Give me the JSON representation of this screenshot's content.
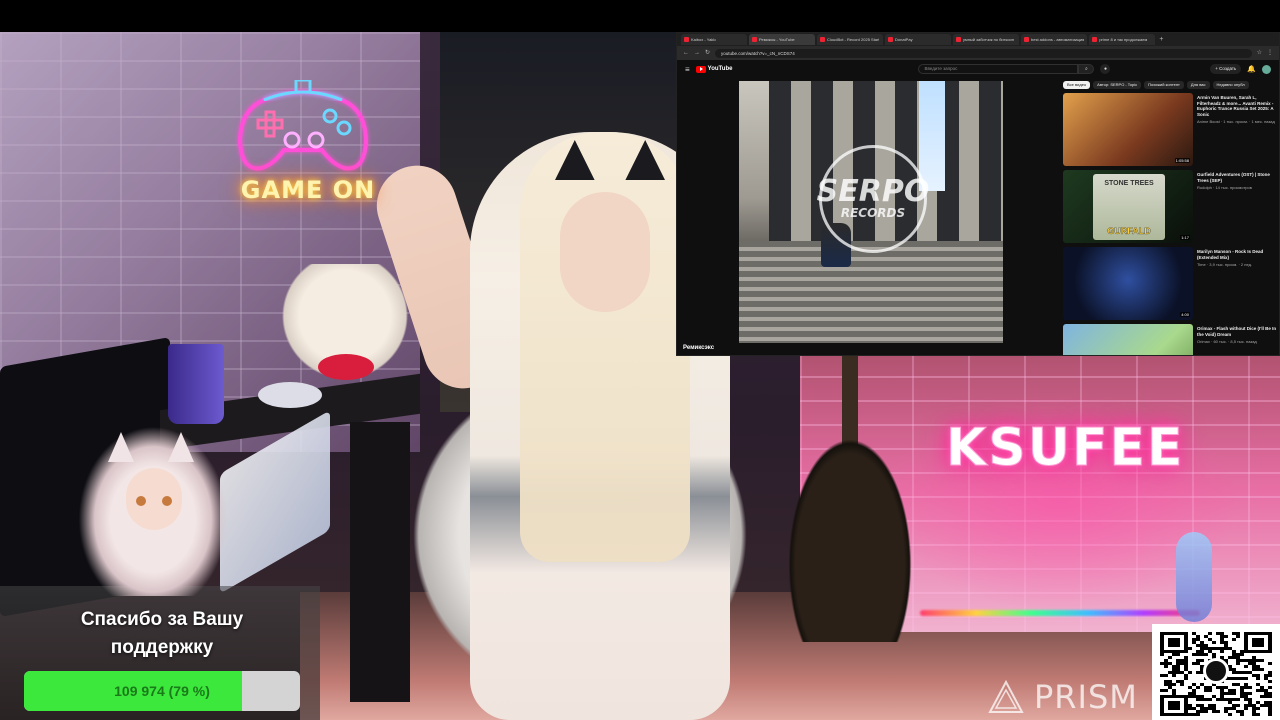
{
  "stream": {
    "neon_game_on": "GAME ON",
    "neon_name": "KSUFEE"
  },
  "browser": {
    "tabs": [
      {
        "label": "Kaibox - Yaklo",
        "active": false
      },
      {
        "label": "Ремиксы - YouTube",
        "active": true
      },
      {
        "label": "CloudBot - Record 2025 Start",
        "active": false
      },
      {
        "label": "DonatPay",
        "active": false
      },
      {
        "label": "умный заботчик по биткоин",
        "active": false
      },
      {
        "label": "best addons - автоматизация",
        "active": false
      },
      {
        "label": "prime 8 и так продолжаем",
        "active": false
      }
    ],
    "url": "youtube.com/watch?v=_cN_nCDS74",
    "youtube": {
      "logo_text": "YouTube",
      "search_placeholder": "Введите запрос",
      "create_label": "+ Создать",
      "channel_name": "Ремиксэкс",
      "video_watermark_main": "SERPO",
      "video_watermark_sub": "RECORDS",
      "chips": [
        "Все видео",
        "Автор: SERPO - Topic",
        "Похожий контент",
        "Для вас",
        "Недавно опубл"
      ],
      "related": [
        {
          "title": "Armin Van Buuren, Sarah L, Filterheadz & more... Avanti Remix - Euphoric Trance Russia Set 2025: A Sonic",
          "sub": "Anime Boost · 1 тыс. просм. · 1 мес. назад",
          "duration": "1:05:58"
        },
        {
          "title": "Gurfield Adventures (OST) | Stone Trees (SEP)",
          "sub": "Rudolph · 14 тыс. просмотров",
          "duration": "1:17",
          "thumb_text_top": "STONE TREES",
          "thumb_text_bottom": "GURFALD"
        },
        {
          "title": "Marilyn Manson - Rock Is Dead (Extended Mix)",
          "sub": "Time · 3,9 тыс. просм. · 2 нед.",
          "duration": "4:00"
        },
        {
          "title": "Orimax - Flash without Dice (I'll Be In the Void) Dream",
          "sub": "Orimax · 60 тыс. · 8,5 тыс. назад",
          "duration": ""
        }
      ]
    }
  },
  "donation": {
    "text_line1": "Спасибо за Вашу",
    "text_line2": "поддержку",
    "progress_label": "109 974 (79 %)",
    "progress_fraction": 0.79
  },
  "watermark": {
    "text": "PRISM"
  },
  "colors": {
    "progress_fill": "#3ce83c",
    "youtube_red": "#ff0000",
    "neon_pink": "#ff2d9a"
  }
}
